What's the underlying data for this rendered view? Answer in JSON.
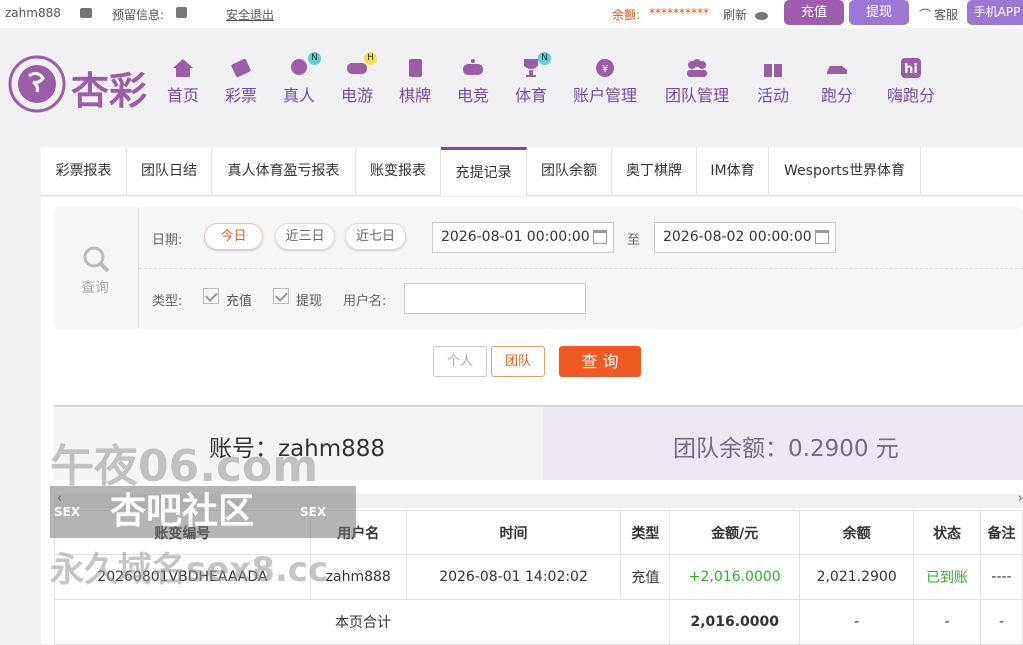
{
  "topbar": {
    "username": "zahm888",
    "reserved_info": "预留信息:",
    "logout": "安全退出",
    "balance_label": "余额:",
    "balance_value": "**********",
    "refresh": "刷新",
    "deposit": "充值",
    "withdraw": "提现",
    "service": "客服",
    "mobile_app": "手机APP"
  },
  "logo": {
    "text": "杏彩"
  },
  "nav": [
    {
      "label": "首页",
      "icon": "home-icon"
    },
    {
      "label": "彩票",
      "icon": "ticket-icon"
    },
    {
      "label": "真人",
      "icon": "dealer-icon",
      "badge": "N"
    },
    {
      "label": "电游",
      "icon": "gamepad-icon",
      "badge": "H"
    },
    {
      "label": "棋牌",
      "icon": "cards-icon"
    },
    {
      "label": "电竞",
      "icon": "esports-icon"
    },
    {
      "label": "体育",
      "icon": "trophy-icon",
      "badge": "N"
    },
    {
      "label": "账户管理",
      "icon": "account-icon"
    },
    {
      "label": "团队管理",
      "icon": "team-icon"
    },
    {
      "label": "活动",
      "icon": "gift-icon"
    },
    {
      "label": "跑分",
      "icon": "car-icon"
    },
    {
      "label": "嗨跑分",
      "icon": "hi-icon"
    }
  ],
  "tabs": [
    "彩票报表",
    "团队日结",
    "真人体育盈亏报表",
    "账变报表",
    "充提记录",
    "团队余额",
    "奥丁棋牌",
    "IM体育",
    "Wesports世界体育"
  ],
  "active_tab": "充提记录",
  "search": {
    "title": "查询",
    "date_label": "日期:",
    "today": "今日",
    "last3": "近三日",
    "last7": "近七日",
    "start_date": "2026-08-01 00:00:00",
    "to": "至",
    "end_date": "2026-08-02 00:00:00",
    "type_label": "类型:",
    "type_deposit": "充值",
    "type_withdraw": "提现",
    "username_label": "用户名:",
    "username_value": "",
    "personal": "个人",
    "team": "团队",
    "query": "查 询"
  },
  "summary": {
    "account": "账号：zahm888",
    "team_balance": "团队余额：0.2900 元"
  },
  "table": {
    "headers": [
      "账变编号",
      "用户名",
      "时间",
      "类型",
      "金额/元",
      "余额",
      "状态",
      "备注"
    ],
    "rows": [
      [
        "20260801VBDHEAAADA",
        "zahm888",
        "2026-08-01 14:02:02",
        "充值",
        "+2,016.0000",
        "2,021.2900",
        "已到账",
        "----"
      ]
    ],
    "total_label": "本页合计",
    "total_amount": "2,016.0000",
    "total_dash": "-"
  },
  "watermark": {
    "line1": "午夜06.com",
    "line2": "杏吧社区",
    "line3": "永久域名sex8.cc",
    "tag": "SEX"
  },
  "colors": {
    "purple": "#a05db0",
    "orange": "#f05a22",
    "green": "#33aa33"
  }
}
